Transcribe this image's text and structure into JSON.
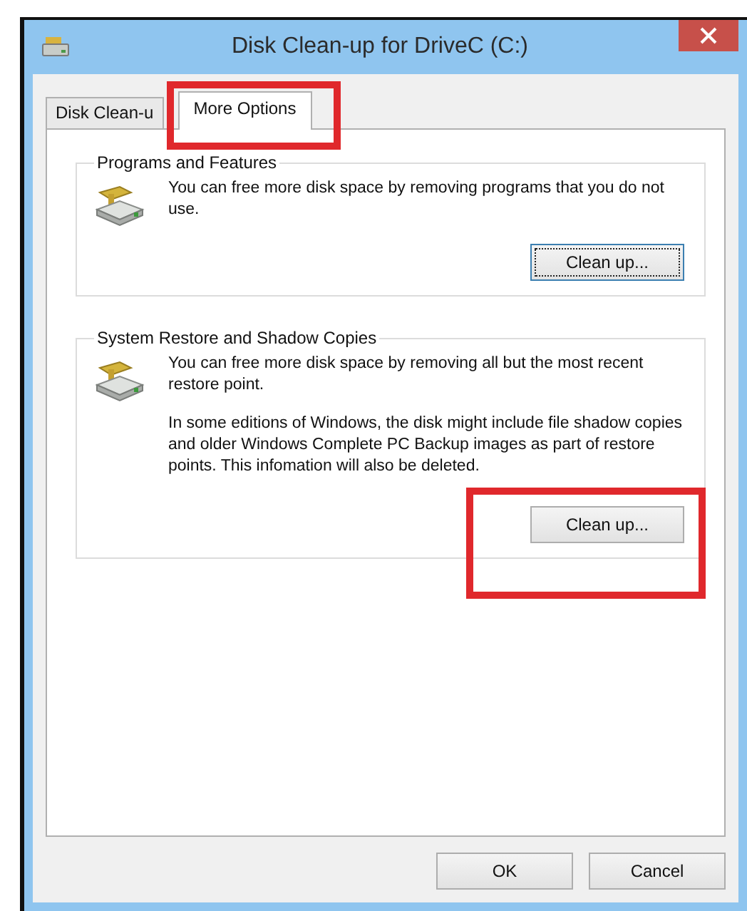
{
  "window": {
    "title": "Disk Clean-up for DriveC (C:)"
  },
  "tabs": [
    {
      "label": "Disk Clean-u",
      "selected": false,
      "highlighted": false
    },
    {
      "label": "More Options",
      "selected": true,
      "highlighted": true
    }
  ],
  "groups": [
    {
      "title": "Programs and Features",
      "paragraphs": [
        "You can free more disk space by removing programs that you do not use."
      ],
      "button": {
        "label": "Clean up...",
        "focused": true,
        "highlighted": false
      }
    },
    {
      "title": "System Restore and Shadow Copies",
      "paragraphs": [
        "You can free more disk space by removing all but the most recent restore point.",
        "In some editions of Windows, the disk might include file shadow copies and older Windows Complete PC Backup images as part of restore points. This infomation will also be deleted."
      ],
      "button": {
        "label": "Clean up...",
        "focused": false,
        "highlighted": true
      }
    }
  ],
  "buttons": [
    "OK",
    "Cancel"
  ]
}
